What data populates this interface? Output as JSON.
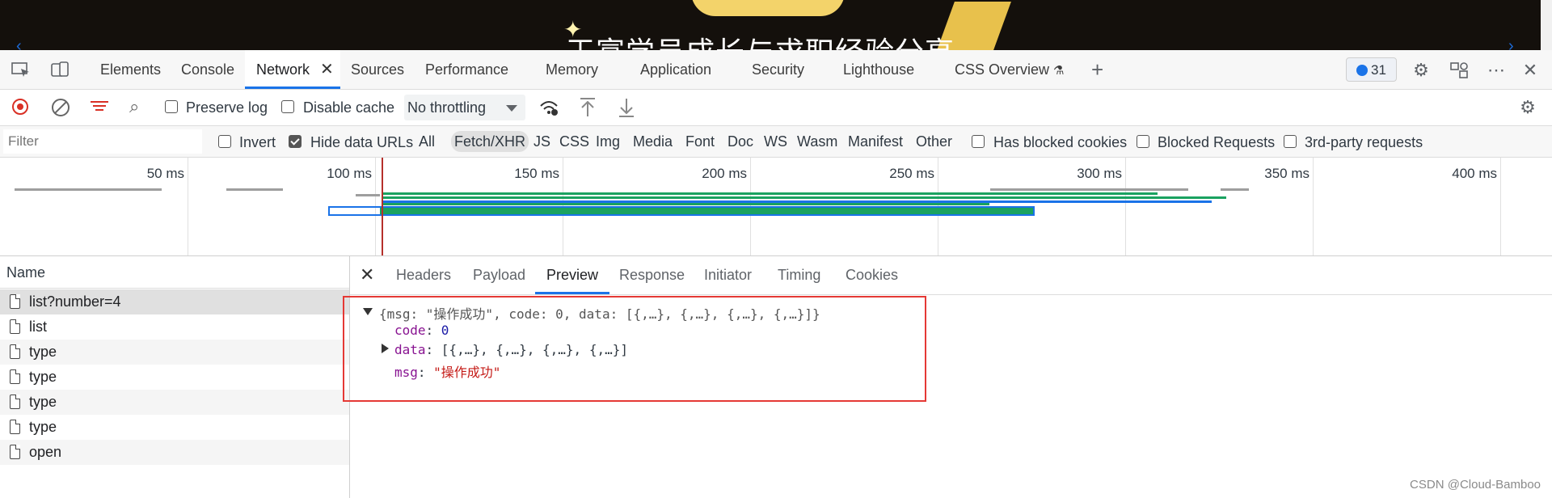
{
  "banner": {
    "title": "王富学员成长与求职经验分享"
  },
  "tabs": [
    {
      "label": "Elements"
    },
    {
      "label": "Console"
    },
    {
      "label": "Network"
    },
    {
      "label": "Sources"
    },
    {
      "label": "Performance"
    },
    {
      "label": "Memory"
    },
    {
      "label": "Application"
    },
    {
      "label": "Security"
    },
    {
      "label": "Lighthouse"
    },
    {
      "label": "CSS Overview"
    }
  ],
  "issues_count": "31",
  "toolbar": {
    "preserve_log": "Preserve log",
    "disable_cache": "Disable cache",
    "throttling": "No throttling"
  },
  "filterbar": {
    "placeholder": "Filter",
    "invert": "Invert",
    "hide_data_urls": "Hide data URLs",
    "types": [
      "All",
      "Fetch/XHR",
      "JS",
      "CSS",
      "Img",
      "Media",
      "Font",
      "Doc",
      "WS",
      "Wasm",
      "Manifest",
      "Other"
    ],
    "has_blocked_cookies": "Has blocked cookies",
    "blocked_requests": "Blocked Requests",
    "third_party": "3rd-party requests"
  },
  "overview": {
    "ticks": [
      "50 ms",
      "100 ms",
      "150 ms",
      "200 ms",
      "250 ms",
      "300 ms",
      "350 ms",
      "400 ms"
    ]
  },
  "requests": {
    "header": "Name",
    "items": [
      "list?number=4",
      "list",
      "type",
      "type",
      "type",
      "type",
      "open"
    ]
  },
  "detail": {
    "tabs": [
      "Headers",
      "Payload",
      "Preview",
      "Response",
      "Initiator",
      "Timing",
      "Cookies"
    ],
    "preview": {
      "summary_open": "{msg: ",
      "summary_msg": "\"操作成功\"",
      "summary_rest": ", code: 0, data: [{,…}, {,…}, {,…}, {,…}]}",
      "code_key": "code",
      "code_val": "0",
      "data_key": "data",
      "data_val": "[{,…}, {,…}, {,…}, {,…}]",
      "msg_key": "msg",
      "msg_val": "\"操作成功\""
    }
  },
  "watermark": "CSDN @Cloud-Bamboo"
}
